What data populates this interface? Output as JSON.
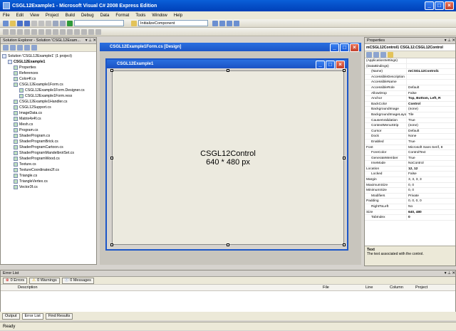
{
  "window": {
    "title": "CSGL12Example1 - Microsoft Visual C# 2008 Express Edition"
  },
  "menu": [
    "File",
    "Edit",
    "View",
    "Project",
    "Build",
    "Debug",
    "Data",
    "Format",
    "Tools",
    "Window",
    "Help"
  ],
  "toolbar": {
    "member_combo": "InitializeComponent"
  },
  "solution_explorer": {
    "title": "Solution Explorer - Solution 'CSGL12Exam...",
    "items": [
      {
        "label": "Solution 'CSGL12Example1' (1 project)",
        "level": 0
      },
      {
        "label": "CSGL12Example1",
        "level": 1,
        "bold": true
      },
      {
        "label": "Properties",
        "level": 2
      },
      {
        "label": "References",
        "level": 2
      },
      {
        "label": "Color4f.cs",
        "level": 2
      },
      {
        "label": "CSGL12Example1Form.cs",
        "level": 2
      },
      {
        "label": "CSGL12Example1Form.Designer.cs",
        "level": 3
      },
      {
        "label": "CSGL12Example1Form.resx",
        "level": 3
      },
      {
        "label": "CSGL12Example1Handler.cs",
        "level": 2
      },
      {
        "label": "CSGL12Support.cs",
        "level": 2
      },
      {
        "label": "ImageData.cs",
        "level": 2
      },
      {
        "label": "Matrix4x4f.cs",
        "level": 2
      },
      {
        "label": "Mesh.cs",
        "level": 2
      },
      {
        "label": "Program.cs",
        "level": 2
      },
      {
        "label": "ShaderProgram.cs",
        "level": 2
      },
      {
        "label": "ShaderProgramBrick.cs",
        "level": 2
      },
      {
        "label": "ShaderProgramCartoon.cs",
        "level": 2
      },
      {
        "label": "ShaderProgramMandelbrotSet.cs",
        "level": 2
      },
      {
        "label": "ShaderProgramWood.cs",
        "level": 2
      },
      {
        "label": "Texture.cs",
        "level": 2
      },
      {
        "label": "TextureCoordinates2f.cs",
        "level": 2
      },
      {
        "label": "Triangle.cs",
        "level": 2
      },
      {
        "label": "TriangleVertex.cs",
        "level": 2
      },
      {
        "label": "Vector3f.cs",
        "level": 2
      }
    ]
  },
  "designer": {
    "tab": "CSGL12Example1Form.cs [Design]",
    "form_title": "CSGL12Example1",
    "control_line1": "CSGL12Control",
    "control_line2": "640 * 480 px"
  },
  "properties": {
    "title": "Properties",
    "object": "mCSGL12Control1 CSGL12.CSGL12Control",
    "rows": [
      {
        "name": "(ApplicationSettings)",
        "value": "",
        "cat": true
      },
      {
        "name": "(DataBindings)",
        "value": "",
        "cat": true
      },
      {
        "name": "(Name)",
        "value": "mCSGL12Control1",
        "bold": true
      },
      {
        "name": "AccessibleDescription",
        "value": ""
      },
      {
        "name": "AccessibleName",
        "value": ""
      },
      {
        "name": "AccessibleRole",
        "value": "Default"
      },
      {
        "name": "AllowDrop",
        "value": "False"
      },
      {
        "name": "Anchor",
        "value": "Top, Bottom, Left, R",
        "bold": true
      },
      {
        "name": "BackColor",
        "value": "Control",
        "bold": true
      },
      {
        "name": "BackgroundImage",
        "value": "(none)"
      },
      {
        "name": "BackgroundImageLayout",
        "value": "Tile"
      },
      {
        "name": "CausesValidation",
        "value": "True"
      },
      {
        "name": "ContextMenuStrip",
        "value": "(none)"
      },
      {
        "name": "Cursor",
        "value": "Default"
      },
      {
        "name": "Dock",
        "value": "None"
      },
      {
        "name": "Enabled",
        "value": "True"
      },
      {
        "name": "Font",
        "value": "Microsoft Sans Serif, 8",
        "cat": true
      },
      {
        "name": "ForeColor",
        "value": "ControlText"
      },
      {
        "name": "GenerateMember",
        "value": "True"
      },
      {
        "name": "ImeMode",
        "value": "NoControl"
      },
      {
        "name": "Location",
        "value": "12, 12",
        "bold": true,
        "cat": true
      },
      {
        "name": "Locked",
        "value": "False"
      },
      {
        "name": "Margin",
        "value": "3, 3, 3, 3",
        "cat": true
      },
      {
        "name": "MaximumSize",
        "value": "0, 0",
        "cat": true
      },
      {
        "name": "MinimumSize",
        "value": "0, 0",
        "cat": true
      },
      {
        "name": "Modifiers",
        "value": "Private"
      },
      {
        "name": "Padding",
        "value": "0, 0, 0, 0",
        "cat": true
      },
      {
        "name": "RightToLeft",
        "value": "No"
      },
      {
        "name": "Size",
        "value": "640, 480",
        "bold": true,
        "cat": true
      },
      {
        "name": "TabIndex",
        "value": "0",
        "bold": true
      }
    ],
    "desc_title": "Text",
    "desc_text": "The text associated with the control."
  },
  "error_list": {
    "title": "Error List",
    "errors": "0 Errors",
    "warnings": "0 Warnings",
    "messages": "0 Messages",
    "columns": [
      "Description",
      "File",
      "Line",
      "Column",
      "Project"
    ]
  },
  "bottom_tabs": [
    "Output",
    "Error List",
    "Find Results"
  ],
  "status": "Ready"
}
